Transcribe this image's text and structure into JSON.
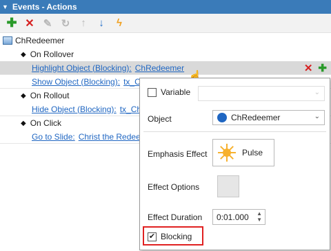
{
  "panel": {
    "title": "Events - Actions"
  },
  "toolbar": {
    "buttons": [
      {
        "name": "add-icon",
        "glyph": "✚"
      },
      {
        "name": "delete-icon",
        "glyph": "✕"
      },
      {
        "name": "edit-icon",
        "glyph": "✎"
      },
      {
        "name": "undo-icon",
        "glyph": "↻"
      },
      {
        "name": "move-up-icon",
        "glyph": "↑"
      },
      {
        "name": "move-down-icon",
        "glyph": "↓"
      },
      {
        "name": "trigger-icon",
        "glyph": "ϟ"
      }
    ]
  },
  "tree": {
    "slide": "ChRedeemer",
    "triggers": {
      "rollover": "On Rollover",
      "rollout": "On Rollout",
      "click": "On Click"
    },
    "actions": {
      "a1": {
        "verb": "Highlight Object (Blocking):",
        "target": "ChRedeemer"
      },
      "a2": {
        "verb": "Show Object (Blocking):",
        "target": "tx_C"
      },
      "a3": {
        "verb": "Hide Object (Blocking):",
        "target": "tx_Ch"
      },
      "a4": {
        "verb": "Go to Slide:",
        "target": "Christ the Redee"
      }
    }
  },
  "popup": {
    "variable_label": "Variable",
    "object_label": "Object",
    "object_value": "ChRedeemer",
    "emphasis_label": "Emphasis Effect",
    "emphasis_value": "Pulse",
    "options_label": "Effect Options",
    "duration_label": "Effect Duration",
    "duration_value": "0:01.000",
    "blocking_label": "Blocking",
    "blocking_checked": true
  },
  "colors": {
    "header": "#3a7bb9",
    "link": "#1f66c2",
    "highlight_border": "#e02020",
    "add": "#2a9a2a",
    "delete": "#d62020"
  }
}
